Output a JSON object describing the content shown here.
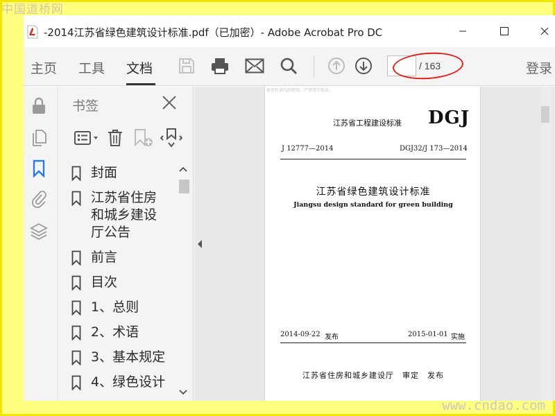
{
  "watermarks": {
    "top": "中国道桥网",
    "bottom": "www.cndao.com"
  },
  "window": {
    "title": "-2014江苏省绿色建筑设计标准.pdf（已加密）- Adobe Acrobat Pro DC"
  },
  "toolbar": {
    "tabs": [
      "主页",
      "工具",
      "文档"
    ],
    "active_tab": "文档",
    "page_current": "",
    "page_total": "/ 163",
    "login": "登录"
  },
  "bookmarks_panel": {
    "title": "书签",
    "items": [
      {
        "label": "封面"
      },
      {
        "label": "江苏省住房和城乡建设厅公告"
      },
      {
        "label": "前言"
      },
      {
        "label": "目次"
      },
      {
        "label": "1、总则"
      },
      {
        "label": "2、术语"
      },
      {
        "label": "3、基本规定"
      },
      {
        "label": "4、绿色设计"
      }
    ]
  },
  "document_page": {
    "faint_text": "本资料供内部使用，严禁用于商业。",
    "standard_label": "江苏省工程建设标准",
    "dgj": "DGJ",
    "j_code": "J 12777—2014",
    "dgj_code": "DGJ32/J 173—2014",
    "title_cn": "江苏省绿色建筑设计标准",
    "title_en": "Jiangsu design standard for green building",
    "pub_date": "2014-09-22",
    "pub_word": "发布",
    "impl_date": "2015-01-01",
    "impl_word": "实施",
    "issuer": "江苏省住房和城乡建设厅　审定　发布"
  },
  "colors": {
    "frame": "#f2e600",
    "background": "#ffff80",
    "bookmark_icon": "#2c7be5",
    "annotation_circle": "#e0201a"
  }
}
